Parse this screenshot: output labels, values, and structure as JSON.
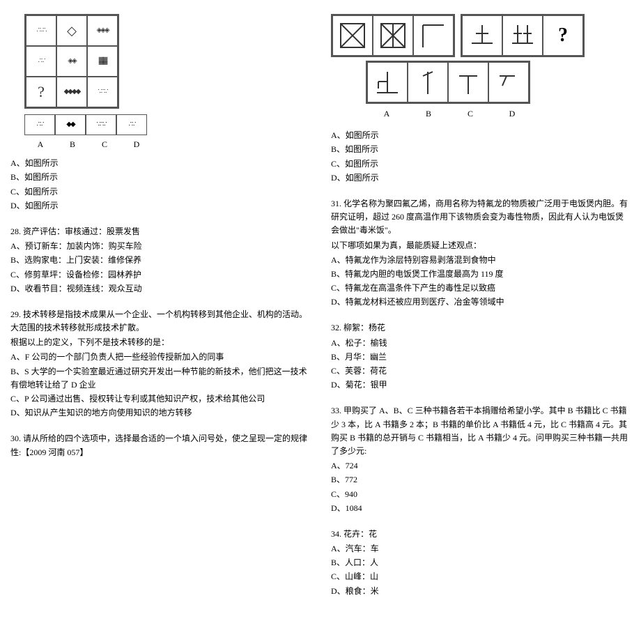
{
  "left": {
    "grid_opts": [
      "A",
      "B",
      "C",
      "D"
    ],
    "opts_img": {
      "a": "A、如图所示",
      "b": "B、如图所示",
      "c": "C、如图所示",
      "d": "D、如图所示"
    },
    "q28": {
      "title": "28. 资产评估：审核通过：股票发售",
      "a": "A、预订新车：加装内饰：购买车险",
      "b": "B、选购家电：上门安装：维修保养",
      "c": "C、修剪草坪：设备检修：园林养护",
      "d": "D、收看节目：视频连线：观众互动"
    },
    "q29": {
      "title": "29. 技术转移是指技术成果从一个企业、一个机构转移到其他企业、机构的活动。大范围的技术转移就形成技术扩散。",
      "sub": "根据以上的定义，下列不是技术转移的是：",
      "a": "A、F 公司的一个部门负责人把一些经验传授新加入的同事",
      "b": "B、S 大学的一个实验室最近通过研究开发出一种节能的新技术，他们把这一技术有偿地转让给了 D 企业",
      "c": "C、P 公司通过出售、授权转让专利或其他知识产权，技术给其他公司",
      "d": "D、知识从产生知识的地方向使用知识的地方转移"
    },
    "q30": "30. 请从所给的四个选项中，选择最合适的一个填入问号处，使之呈现一定的规律性:【2009 河南 057】"
  },
  "right": {
    "q30_labels": [
      "A",
      "B",
      "C",
      "D"
    ],
    "opts_img": {
      "a": "A、如图所示",
      "b": "B、如图所示",
      "c": "C、如图所示",
      "d": "D、如图所示"
    },
    "q31": {
      "title": "31. 化学名称为聚四氟乙烯，商用名称为特氟龙的物质被广泛用于电饭煲内胆。有研究证明，超过 260 度高温作用下该物质会变为毒性物质，因此有人认为电饭煲会做出\"毒米饭\"。",
      "sub": "以下哪项如果为真，最能质疑上述观点：",
      "a": "A、特氟龙作为涂层特别容易剥落混到食物中",
      "b": "B、特氟龙内胆的电饭煲工作温度最高为 119 度",
      "c": "C、特氟龙在高温条件下产生的毒性足以致癌",
      "d": "D、特氟龙材料还被应用到医疗、冶金等领域中"
    },
    "q32": {
      "title": "32. 柳絮：杨花",
      "a": "A、松子：榆钱",
      "b": "B、月华：幽兰",
      "c": "C、芙蓉：荷花",
      "d": "D、菊花：银甲"
    },
    "q33": {
      "title": "33. 甲购买了 A、B、C 三种书籍各若干本捐赠给希望小学。其中 B 书籍比 C 书籍少 3 本，比 A 书籍多 2 本；B 书籍的单价比 A 书籍低 4 元，比 C 书籍高 4 元。其购买 B 书籍的总开销与 C 书籍相当，比 A 书籍少 4 元。问甲购买三种书籍一共用了多少元:",
      "a": "A、724",
      "b": "B、772",
      "c": "C、940",
      "d": "D、1084"
    },
    "q34": {
      "title": "34. 花卉：花",
      "a": "A、汽车：车",
      "b": "B、人口：人",
      "c": "C、山峰：山",
      "d": "D、粮食：米"
    }
  }
}
